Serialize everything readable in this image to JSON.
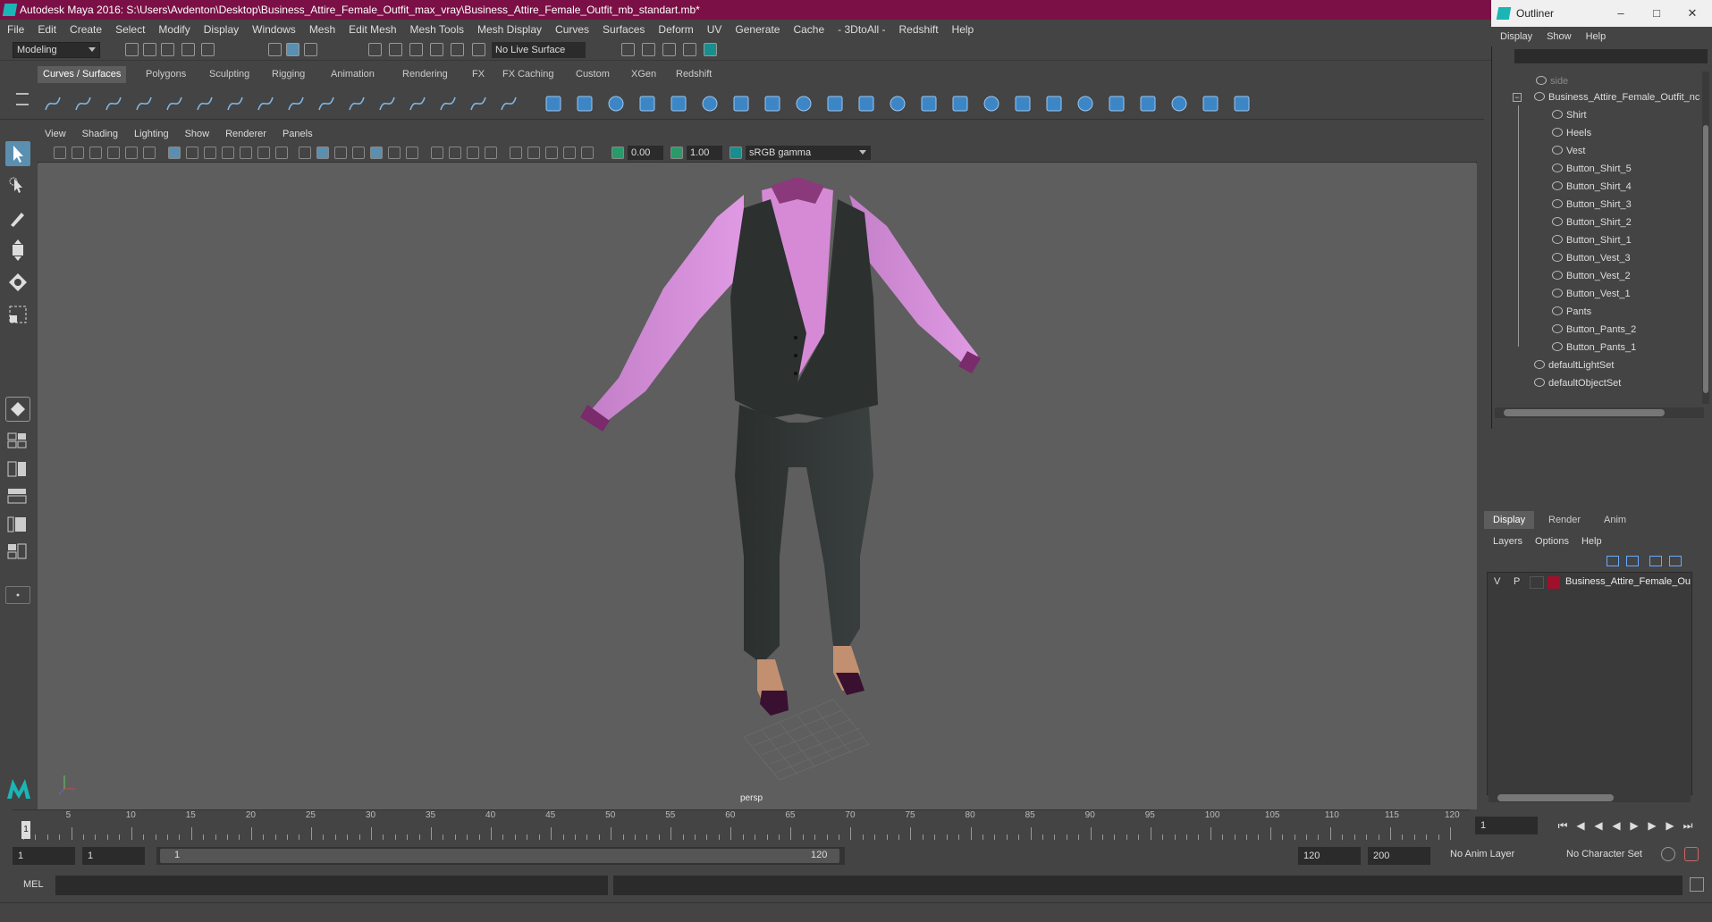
{
  "window": {
    "title": "Autodesk Maya 2016: S:\\Users\\Avdenton\\Desktop\\Business_Attire_Female_Outfit_max_vray\\Business_Attire_Female_Outfit_mb_standart.mb*"
  },
  "menubar": [
    "File",
    "Edit",
    "Create",
    "Select",
    "Modify",
    "Display",
    "Windows",
    "Mesh",
    "Edit Mesh",
    "Mesh Tools",
    "Mesh Display",
    "Curves",
    "Surfaces",
    "Deform",
    "UV",
    "Generate",
    "Cache",
    "- 3DtoAll -",
    "Redshift",
    "Help"
  ],
  "statusline": {
    "mode": "Modeling",
    "live_surface": "No Live Surface"
  },
  "shelf": {
    "tabs": [
      "Curves / Surfaces",
      "Polygons",
      "Sculpting",
      "Rigging",
      "Animation",
      "Rendering",
      "FX",
      "FX Caching",
      "Custom",
      "XGen",
      "Redshift"
    ],
    "active_tab": "Curves / Surfaces"
  },
  "viewport": {
    "menu": [
      "View",
      "Shading",
      "Lighting",
      "Show",
      "Renderer",
      "Panels"
    ],
    "exposure": "0.00",
    "gamma": "1.00",
    "color_space": "sRGB gamma",
    "camera_label": "persp"
  },
  "outliner": {
    "title": "Outliner",
    "menu": [
      "Display",
      "Show",
      "Help"
    ],
    "top_item": "side",
    "root": "Business_Attire_Female_Outfit_nc",
    "children": [
      "Shirt",
      "Heels",
      "Vest",
      "Button_Shirt_5",
      "Button_Shirt_4",
      "Button_Shirt_3",
      "Button_Shirt_2",
      "Button_Shirt_1",
      "Button_Vest_3",
      "Button_Vest_2",
      "Button_Vest_1",
      "Pants",
      "Button_Pants_2",
      "Button_Pants_1"
    ],
    "sets": [
      "defaultLightSet",
      "defaultObjectSet"
    ]
  },
  "layers": {
    "tabs": [
      "Display",
      "Render",
      "Anim"
    ],
    "active_tab": "Display",
    "menu": [
      "Layers",
      "Options",
      "Help"
    ],
    "row": {
      "v": "V",
      "p": "P",
      "name": "Business_Attire_Female_Ou",
      "color": "#a0102c"
    }
  },
  "timeline": {
    "ticks": [
      "5",
      "10",
      "15",
      "20",
      "25",
      "30",
      "35",
      "40",
      "45",
      "50",
      "55",
      "60",
      "65",
      "70",
      "75",
      "80",
      "85",
      "90",
      "95",
      "100",
      "105",
      "110",
      "115",
      "120"
    ],
    "current_frame_marker": "1",
    "current_frame": "1"
  },
  "range": {
    "start": "1",
    "start2": "1",
    "slider_start": "1",
    "slider_end": "120",
    "end": "120",
    "end2": "200",
    "anim_layer": "No Anim Layer",
    "character_set": "No Character Set"
  },
  "cmdline": {
    "label": "MEL"
  },
  "colors": {
    "titlebar": "#7a1046",
    "accent": "#1bb5b5",
    "shirt": "#d68ad6",
    "vest": "#2c302f"
  }
}
